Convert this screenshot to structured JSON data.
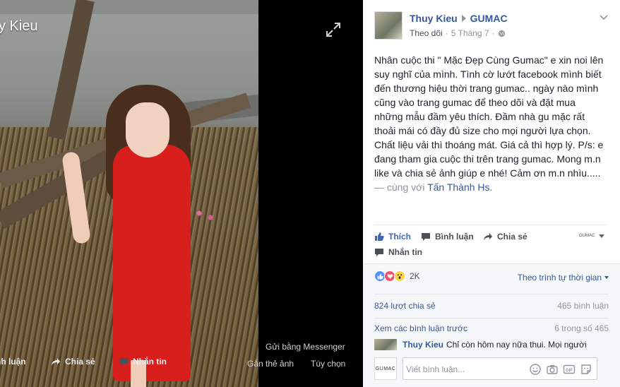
{
  "viewer": {
    "owner_name": "y Kieu",
    "send_messenger": "Gửi bằng Messenger",
    "actions": {
      "comment": "nh luận",
      "share": "Chia sẻ",
      "messenger": "Nhắn tin"
    },
    "tag_photo": "Gắn thẻ ảnh",
    "options": "Tùy chọn"
  },
  "post": {
    "author": "Thuy Kieu",
    "target_page": "GUMAC",
    "follow_label": "Theo dõi",
    "separator": "·",
    "date": "5 Tháng 7",
    "text_lines": [
      "Nhân cuộc thi \" Mặc Đẹp Cùng Gumac\" e xin noi lên",
      "suy nghĩ của mình. Tình cờ lướt facebook mình biết",
      "đến thương hiệu thời trang gumac.. ngày nào mình",
      "cũng vào trang gumac để theo dõi và đặt mua",
      "những mẫu đầm yêu thích. Đầm nhà gu mặc rất",
      "thoải mái có đầy đủ size cho mọi người lựa chọn.",
      "Chất liệu vải thì thoáng mát. Giá cả thì hợp lý. P/s: e",
      "đang tham gia cuộc thi trên trang gumac. Mong m.n",
      "like và chia sẻ ảnh giúp e nhé! Cảm ơn m.n nhìu....."
    ],
    "with_prefix": "— cùng với ",
    "tagged_person": "Tấn Thành Hs",
    "with_suffix": ".",
    "actions": {
      "like": "Thích",
      "comment": "Bình luận",
      "share": "Chia sẻ",
      "message": "Nhắn tin"
    },
    "page_selector": "GUMAC"
  },
  "engagement": {
    "reactions": [
      "like",
      "love",
      "wow"
    ],
    "reaction_count": "2K",
    "sort_label": "Theo trình tự thời gian",
    "shares": "824 lượt chia sẻ",
    "comments": "465 bình luận",
    "view_previous": "Xem các bình luận trước",
    "position": "6 trong số 465"
  },
  "comment": {
    "author": "Thuy Kieu",
    "text": "Chỉ còn hôm nay nữa thui. Mọi người"
  },
  "composer": {
    "avatar_text": "GUMAC",
    "placeholder": "Viết bình luận..."
  },
  "colors": {
    "link": "#365899",
    "like_blue": "#4267b2",
    "dress_red": "#d91f1c"
  }
}
